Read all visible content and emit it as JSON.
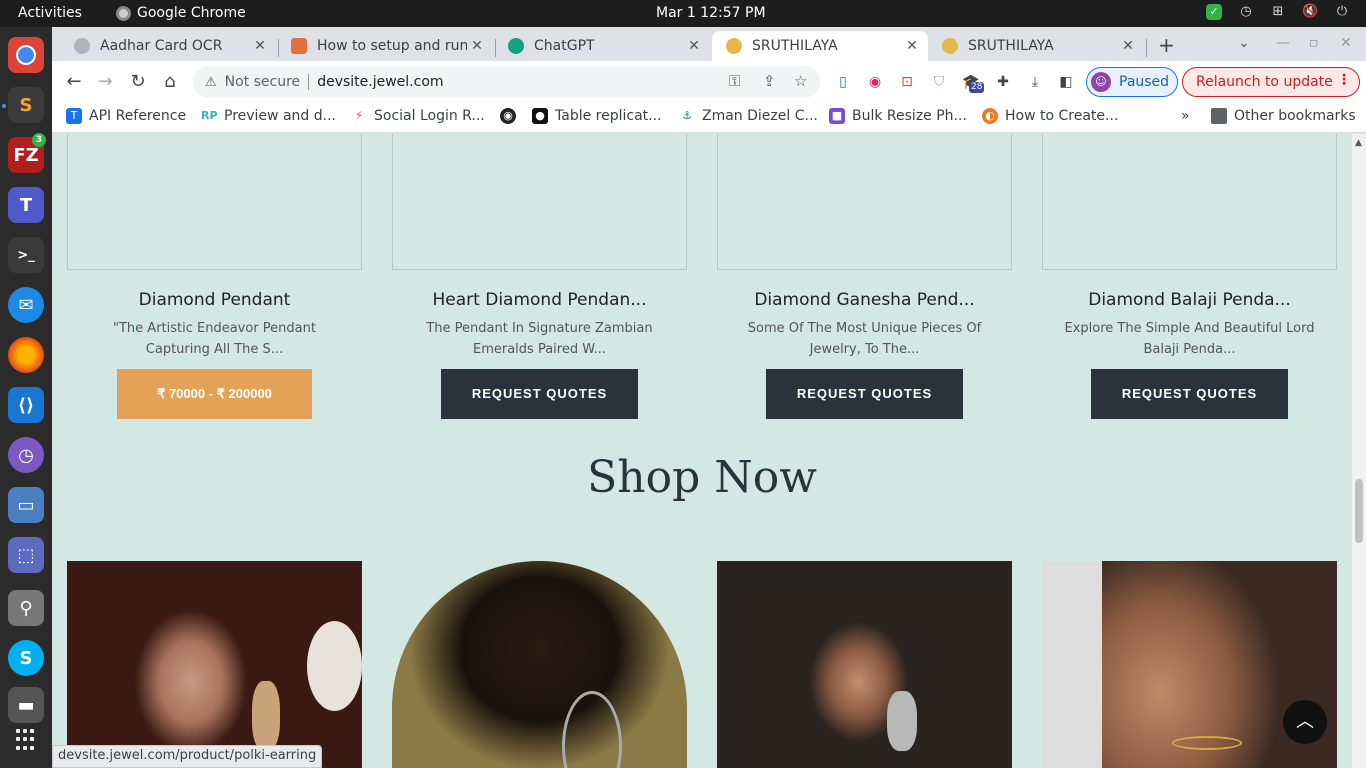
{
  "system": {
    "activities": "Activities",
    "app_name": "Google Chrome",
    "clock": "Mar 1  12:57 PM"
  },
  "dock": {
    "filezilla_badge": "3"
  },
  "tabs": [
    {
      "title": "Aadhar Card OCR",
      "favicon_color": "#b0b4b8"
    },
    {
      "title": "How to setup and run",
      "favicon_color": "#e07040"
    },
    {
      "title": "ChatGPT",
      "favicon_color": "#10a37f"
    },
    {
      "title": "SRUTHILAYA",
      "favicon_color": "#e6b84a"
    },
    {
      "title": "SRUTHILAYA",
      "favicon_color": "#e6b84a"
    }
  ],
  "toolbar": {
    "security_label": "Not secure",
    "url": "devsite.jewel.com",
    "ext_badge": "28",
    "paused_label": "Paused",
    "relaunch_label": "Relaunch to update"
  },
  "bookmarks": {
    "items": [
      {
        "label": "API Reference",
        "icon": "T",
        "color": "#1a73e8"
      },
      {
        "label": "Preview and d...",
        "icon": "RP",
        "color": "#39b6a4"
      },
      {
        "label": "Social Login R...",
        "icon": "⚡",
        "color": "#e0412c"
      },
      {
        "label": "",
        "icon": "◉",
        "color": "#222"
      },
      {
        "label": "Table replicat...",
        "icon": "●",
        "color": "#111"
      },
      {
        "label": "Zman Diezel C...",
        "icon": "⚓",
        "color": "#2a6db0"
      },
      {
        "label": "Bulk Resize Ph...",
        "icon": "■",
        "color": "#7a4bd6"
      },
      {
        "label": "How to Create...",
        "icon": "◐",
        "color": "#f07a23"
      }
    ],
    "overflow": "»",
    "other": "Other bookmarks"
  },
  "products": [
    {
      "name": "Diamond Pendant",
      "desc": "\"The Artistic Endeavor Pendant Capturing All The S...",
      "button": "₹ 70000 - ₹ 200000",
      "is_price": true
    },
    {
      "name": "Heart Diamond Pendan...",
      "desc": "The Pendant In Signature Zambian Emeralds Paired W...",
      "button": "REQUEST QUOTES",
      "is_price": false
    },
    {
      "name": "Diamond Ganesha Pend...",
      "desc": "Some Of The Most Unique Pieces Of Jewelry, To The...",
      "button": "REQUEST QUOTES",
      "is_price": false
    },
    {
      "name": "Diamond Balaji Penda...",
      "desc": "Explore The Simple And Beautiful Lord Balaji Penda...",
      "button": "REQUEST QUOTES",
      "is_price": false
    }
  ],
  "section": {
    "heading": "Shop Now"
  },
  "status_bar": {
    "url": "devsite.jewel.com/product/polki-earring"
  },
  "colors": {
    "page_bg": "#d3e8e3",
    "button_dark": "#2a333b",
    "price_button": "#e4a257"
  }
}
